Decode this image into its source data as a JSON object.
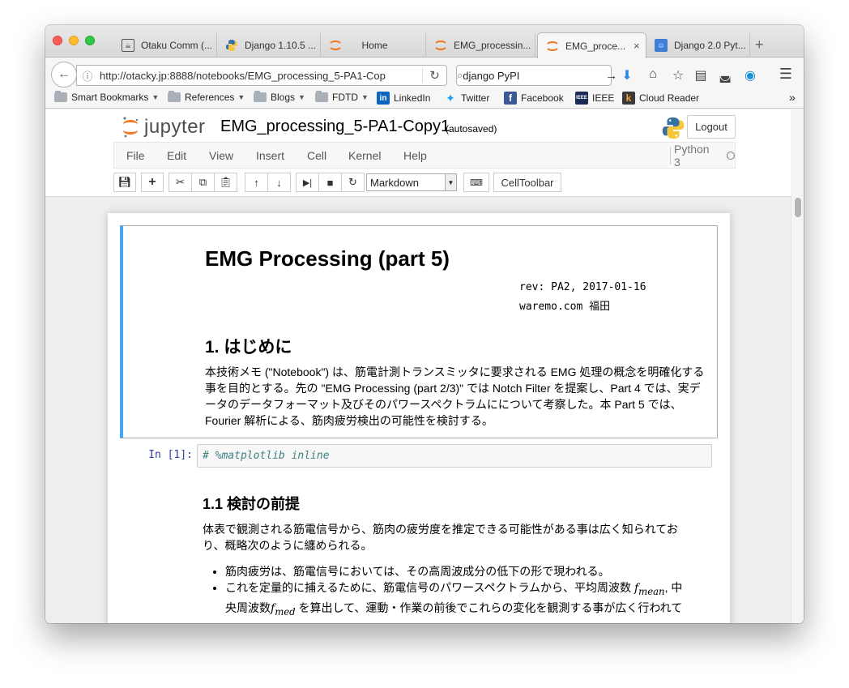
{
  "browser": {
    "tabs": [
      {
        "title": "Otaku Comm (...",
        "icon": "otaku-favicon"
      },
      {
        "title": "Django 1.10.5 ...",
        "icon": "python-favicon"
      },
      {
        "title": "Home",
        "icon": "jupyter-favicon"
      },
      {
        "title": "EMG_processin...",
        "icon": "jupyter-favicon"
      },
      {
        "title": "EMG_proce...",
        "icon": "jupyter-favicon",
        "active": true
      },
      {
        "title": "Django 2.0 Pyt...",
        "icon": "pypi-favicon"
      }
    ],
    "tab_close_glyph": "×",
    "newtab_glyph": "+",
    "url": "http://otacky.jp:8888/notebooks/EMG_processing_5-PA1-Cop",
    "search_value": "django PyPI",
    "bookmarks": [
      {
        "label": "Smart Bookmarks",
        "folder": true
      },
      {
        "label": "References",
        "folder": true
      },
      {
        "label": "Blogs",
        "folder": true
      },
      {
        "label": "FDTD",
        "folder": true
      },
      {
        "label": "LinkedIn",
        "icon": "linkedin-icon"
      },
      {
        "label": "Twitter",
        "icon": "twitter-icon"
      },
      {
        "label": "Facebook",
        "icon": "facebook-icon"
      },
      {
        "label": "IEEE",
        "icon": "ieee-icon"
      },
      {
        "label": "Cloud Reader",
        "icon": "kindle-icon"
      }
    ],
    "bookmark_overflow": "»"
  },
  "jupyter": {
    "logo_text": "jupyter",
    "notebook_name": "EMG_processing_5-PA1-Copy1",
    "autosave": "(autosaved)",
    "logout_label": "Logout",
    "menu": [
      "File",
      "Edit",
      "View",
      "Insert",
      "Cell",
      "Kernel",
      "Help"
    ],
    "kernel_name": "Python 3",
    "cell_type": "Markdown",
    "celltoolbar_label": "CellToolbar"
  },
  "notebook": {
    "title": "EMG Processing (part 5)",
    "rev_line1": "rev: PA2, 2017-01-16",
    "rev_line2": "waremo.com 福田",
    "section1": "1. はじめに",
    "intro": "本技術メモ (\"Notebook\") は、筋電計測トランスミッタに要求される EMG 処理の概念を明確化する事を目的とする。先の \"EMG Processing (part 2/3)\" では Notch Filter を提案し、Part 4 では、実データのデータフォーマット及びそのパワースペクトラムにについて考察した。本 Part 5 では、Fourier 解析による、筋肉疲労検出の可能性を検討する。",
    "code_prompt": "In [1]:",
    "code": "# %matplotlib inline",
    "section11": "1.1 検討の前提",
    "para2": "体表で観測される筋電信号から、筋肉の疲労度を推定できる可能性がある事は広く知られており、概略次のように纏められる。",
    "bullet1": "筋肉疲労は、筋電信号においては、その高周波成分の低下の形で現われる。",
    "bullet2_a": "これを定量的に捕えるために、筋電信号のパワースペクトラムから、平均周波数",
    "bullet2_fmean": "f",
    "bullet2_fmean_sub": "mean",
    "bullet2_b": ", 中央周波数",
    "bullet2_fmed": "f",
    "bullet2_fmed_sub": "med",
    "bullet2_c": " を算出して、運動・作業の前後でこれらの変化を観測する事が広く行われている。"
  }
}
